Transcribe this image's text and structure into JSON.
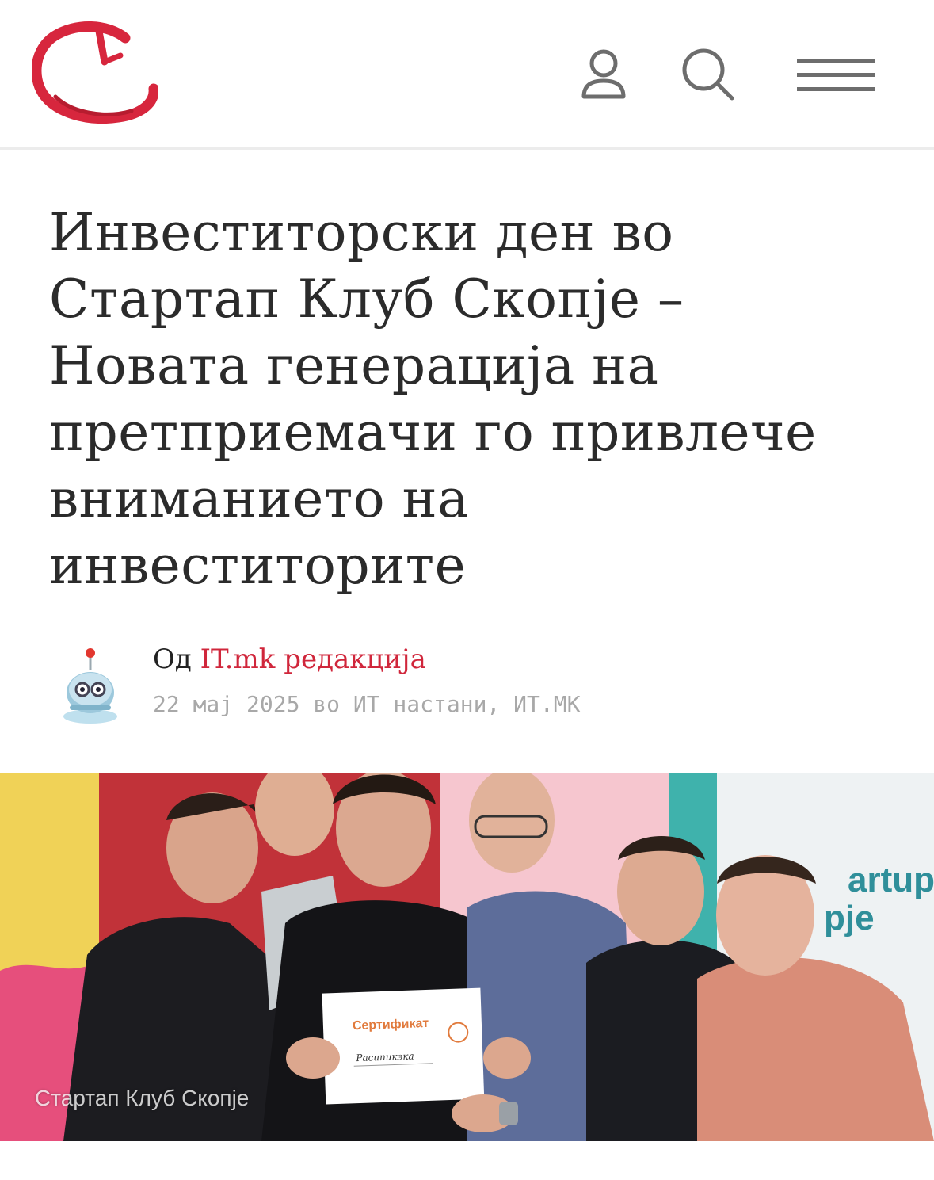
{
  "header": {
    "logo_icon": "itmk-clock-logo-icon",
    "user_icon": "user-icon",
    "search_icon": "search-icon",
    "menu_icon": "hamburger-menu-icon",
    "brand_color": "#d0263b"
  },
  "article": {
    "title_lines": [
      "Инвеститорски ден во",
      "Стартап Клуб Скопје –",
      "Новата генерација на",
      "претприемачи го привлече",
      "вниманието на",
      "инвеститорите"
    ],
    "byline_prefix": "Од",
    "author": "IT.mk редакција",
    "meta": "22 мај 2025 во ИТ настани, ИТ.МК",
    "image_caption": "Стартап Клуб Скопје",
    "photo_texts": {
      "sign_line1": "artup Cl",
      "sign_line2": "pje",
      "certificate_title": "Сертификат",
      "certificate_name": "Расипикэка"
    }
  }
}
